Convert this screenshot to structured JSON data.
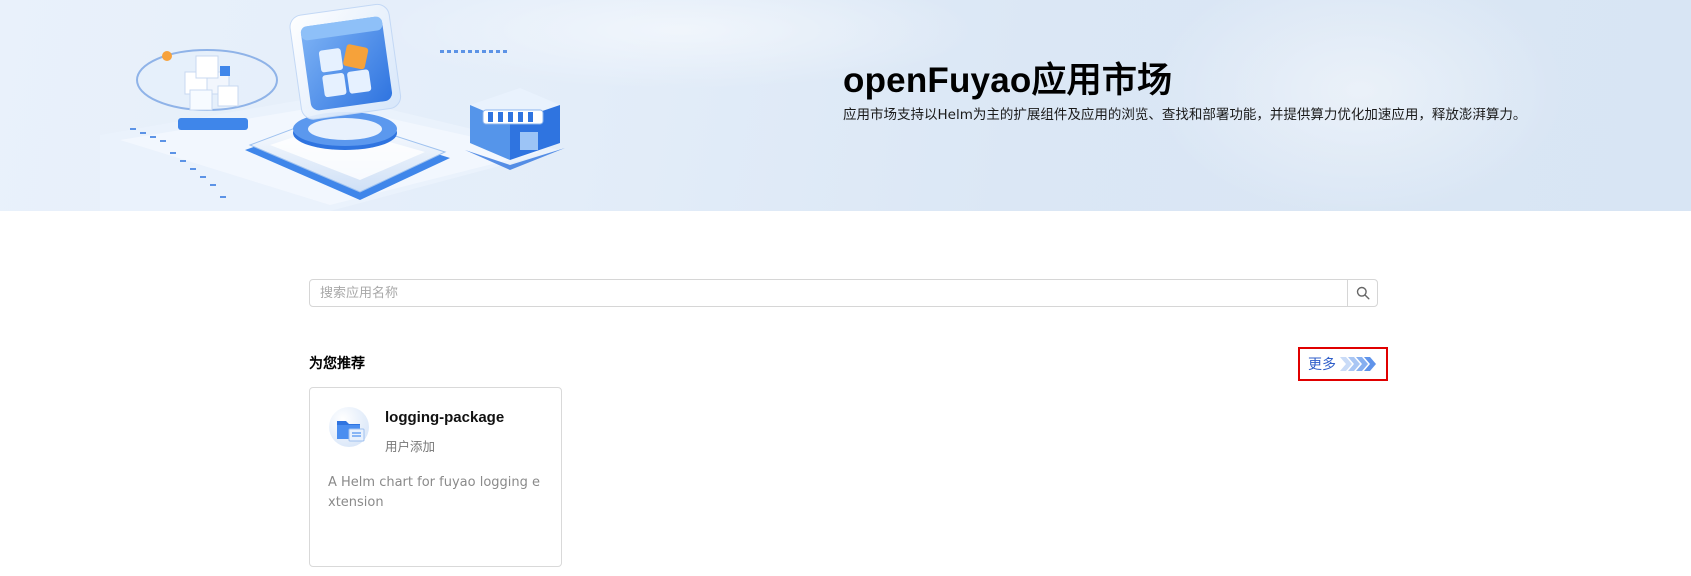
{
  "banner": {
    "title": "openFuyao应用市场",
    "description": "应用市场支持以Helm为主的扩展组件及应用的浏览、查找和部署功能，并提供算力优化加速应用，释放澎湃算力。"
  },
  "search": {
    "placeholder": "搜索应用名称",
    "value": "",
    "icon": "search-icon"
  },
  "recommended": {
    "title": "为您推荐",
    "more_label": "更多",
    "more_icon": "chevrons-right-icon",
    "cards": [
      {
        "name": "logging-package",
        "source": "用户添加",
        "description": "A Helm chart for fuyao logging extension",
        "icon": "package-folder-icon"
      }
    ]
  },
  "colors": {
    "accent": "#2f5ec9",
    "highlight_border": "#e00000",
    "banner_bg": "#dde9f6"
  }
}
